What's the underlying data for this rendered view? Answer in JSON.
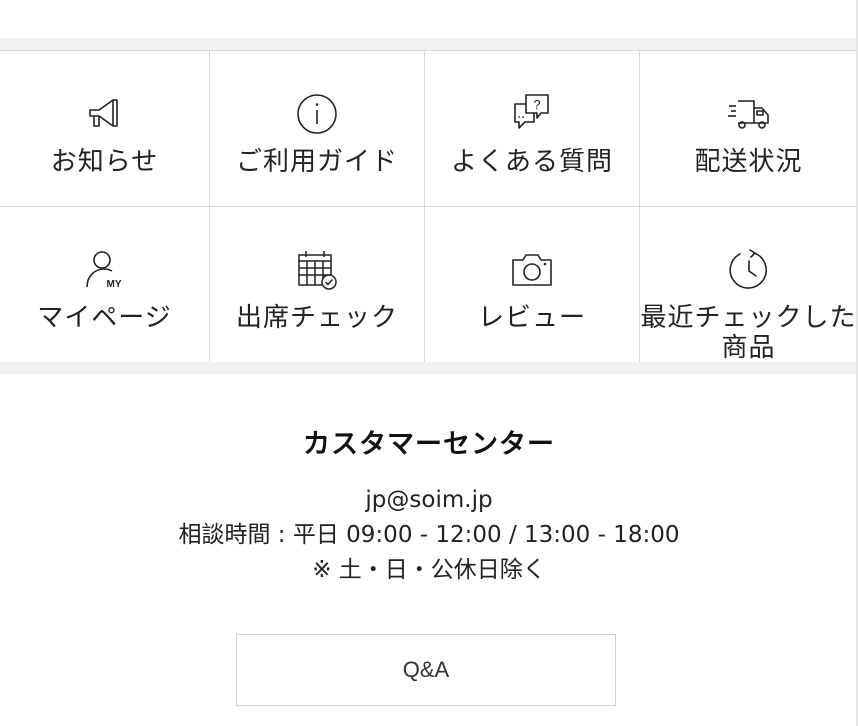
{
  "menu": {
    "items": [
      {
        "label": "お知らせ",
        "icon": "megaphone-icon"
      },
      {
        "label": "ご利用ガイド",
        "icon": "info-icon"
      },
      {
        "label": "よくある質問",
        "icon": "faq-chat-icon"
      },
      {
        "label": "配送状況",
        "icon": "delivery-truck-icon"
      },
      {
        "label": "マイページ",
        "icon": "user-my-icon"
      },
      {
        "label": "出席チェック",
        "icon": "calendar-check-icon"
      },
      {
        "label": "レビュー",
        "icon": "camera-icon"
      },
      {
        "label": "最近チェックした商品",
        "icon": "clock-icon"
      }
    ]
  },
  "icon_text": {
    "faq_mark": "?",
    "my_mark": "MY"
  },
  "customer_center": {
    "title": "カスタマーセンター",
    "email": "jp@soim.jp",
    "hours": "相談時間 : 平日 09:00 - 12:00 / 13:00 - 18:00",
    "note": "※ 土・日・公休日除く",
    "qa_label": "Q&A"
  },
  "colors": {
    "border": "#d9d9d9",
    "band": "#f2f2f2",
    "text": "#222222"
  }
}
